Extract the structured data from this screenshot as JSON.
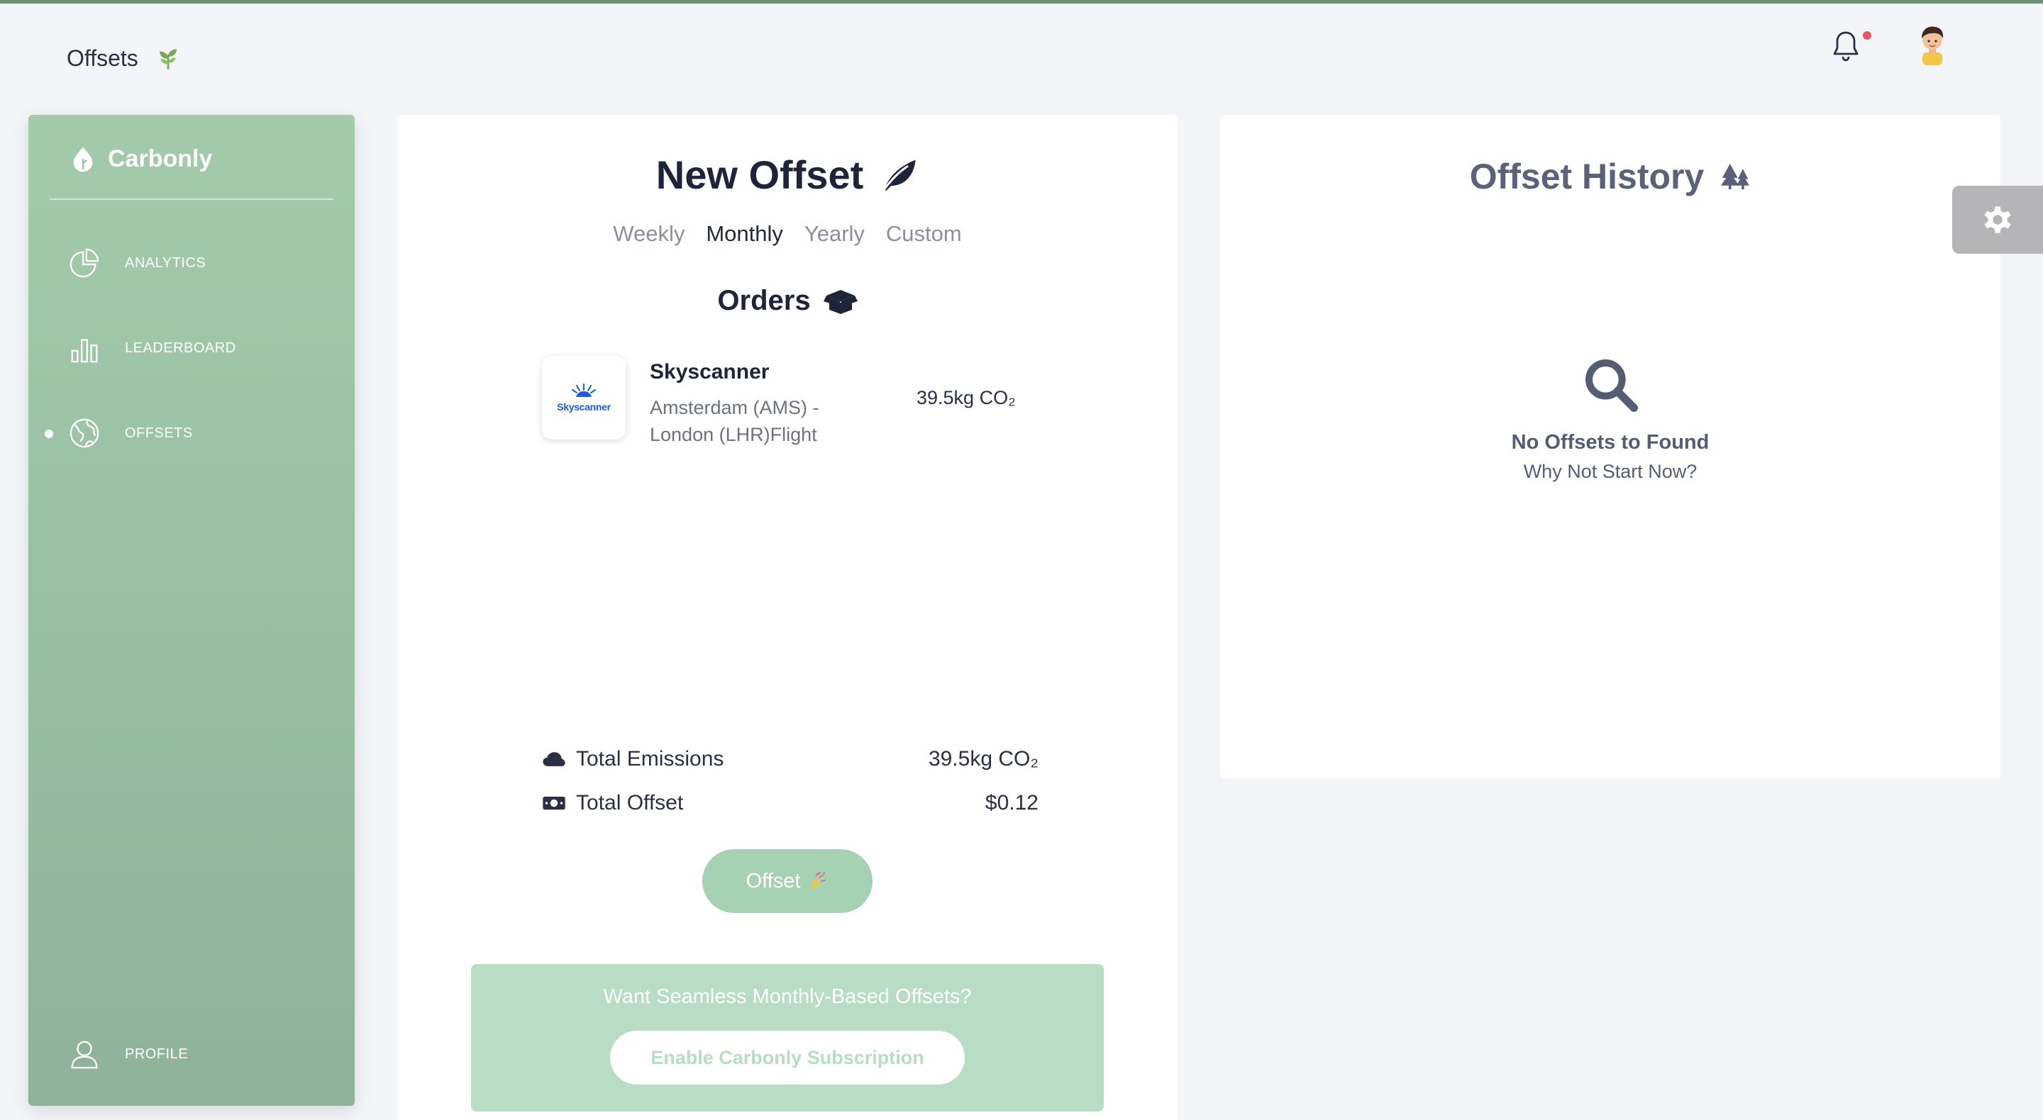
{
  "header": {
    "page_title": "Offsets",
    "title_icon": "sprout-leaf-icon",
    "notification_icon": "bell-icon",
    "avatar_icon": "user-avatar-icon"
  },
  "sidebar": {
    "brand": "Carbonly",
    "brand_icon": "leaf-drop-icon",
    "items": [
      {
        "label": "ANALYTICS",
        "icon": "pie-chart-icon",
        "active": false
      },
      {
        "label": "LEADERBOARD",
        "icon": "bar-chart-icon",
        "active": false
      },
      {
        "label": "OFFSETS",
        "icon": "globe-icon",
        "active": true
      },
      {
        "label": "PROFILE",
        "icon": "user-icon",
        "active": false
      }
    ]
  },
  "new_offset": {
    "title": "New Offset",
    "title_icon": "feather-leaf-icon",
    "tabs": [
      {
        "label": "Weekly",
        "active": false
      },
      {
        "label": "Monthly",
        "active": true
      },
      {
        "label": "Yearly",
        "active": false
      },
      {
        "label": "Custom",
        "active": false
      }
    ],
    "orders_title": "Orders",
    "orders_icon": "open-box-icon",
    "orders": [
      {
        "logo_text": "Skyscanner",
        "name": "Skyscanner",
        "route": "Amsterdam (AMS) - London (LHR)Flight",
        "amount": "39.5kg CO₂"
      }
    ],
    "total_emissions_label": "Total Emissions",
    "total_emissions_icon": "cloud-icon",
    "total_emissions_value": "39.5kg CO₂",
    "total_offset_label": "Total Offset",
    "total_offset_icon": "money-bill-icon",
    "total_offset_value": "$0.12",
    "offset_button": "Offset",
    "offset_button_icon": "party-popper-icon",
    "promo_text": "Want Seamless Monthly-Based Offsets?",
    "promo_button": "Enable Carbonly Subscription"
  },
  "history": {
    "title": "Offset History",
    "title_icon": "trees-icon",
    "empty_icon": "search-icon",
    "empty_title": "No Offsets to Found",
    "empty_subtitle": "Why Not Start Now?"
  },
  "settings_icon": "gear-icon",
  "colors": {
    "accent_green": "#a3cbab",
    "promo_green": "#b9dcc4",
    "notification_dot": "#e5566a"
  }
}
